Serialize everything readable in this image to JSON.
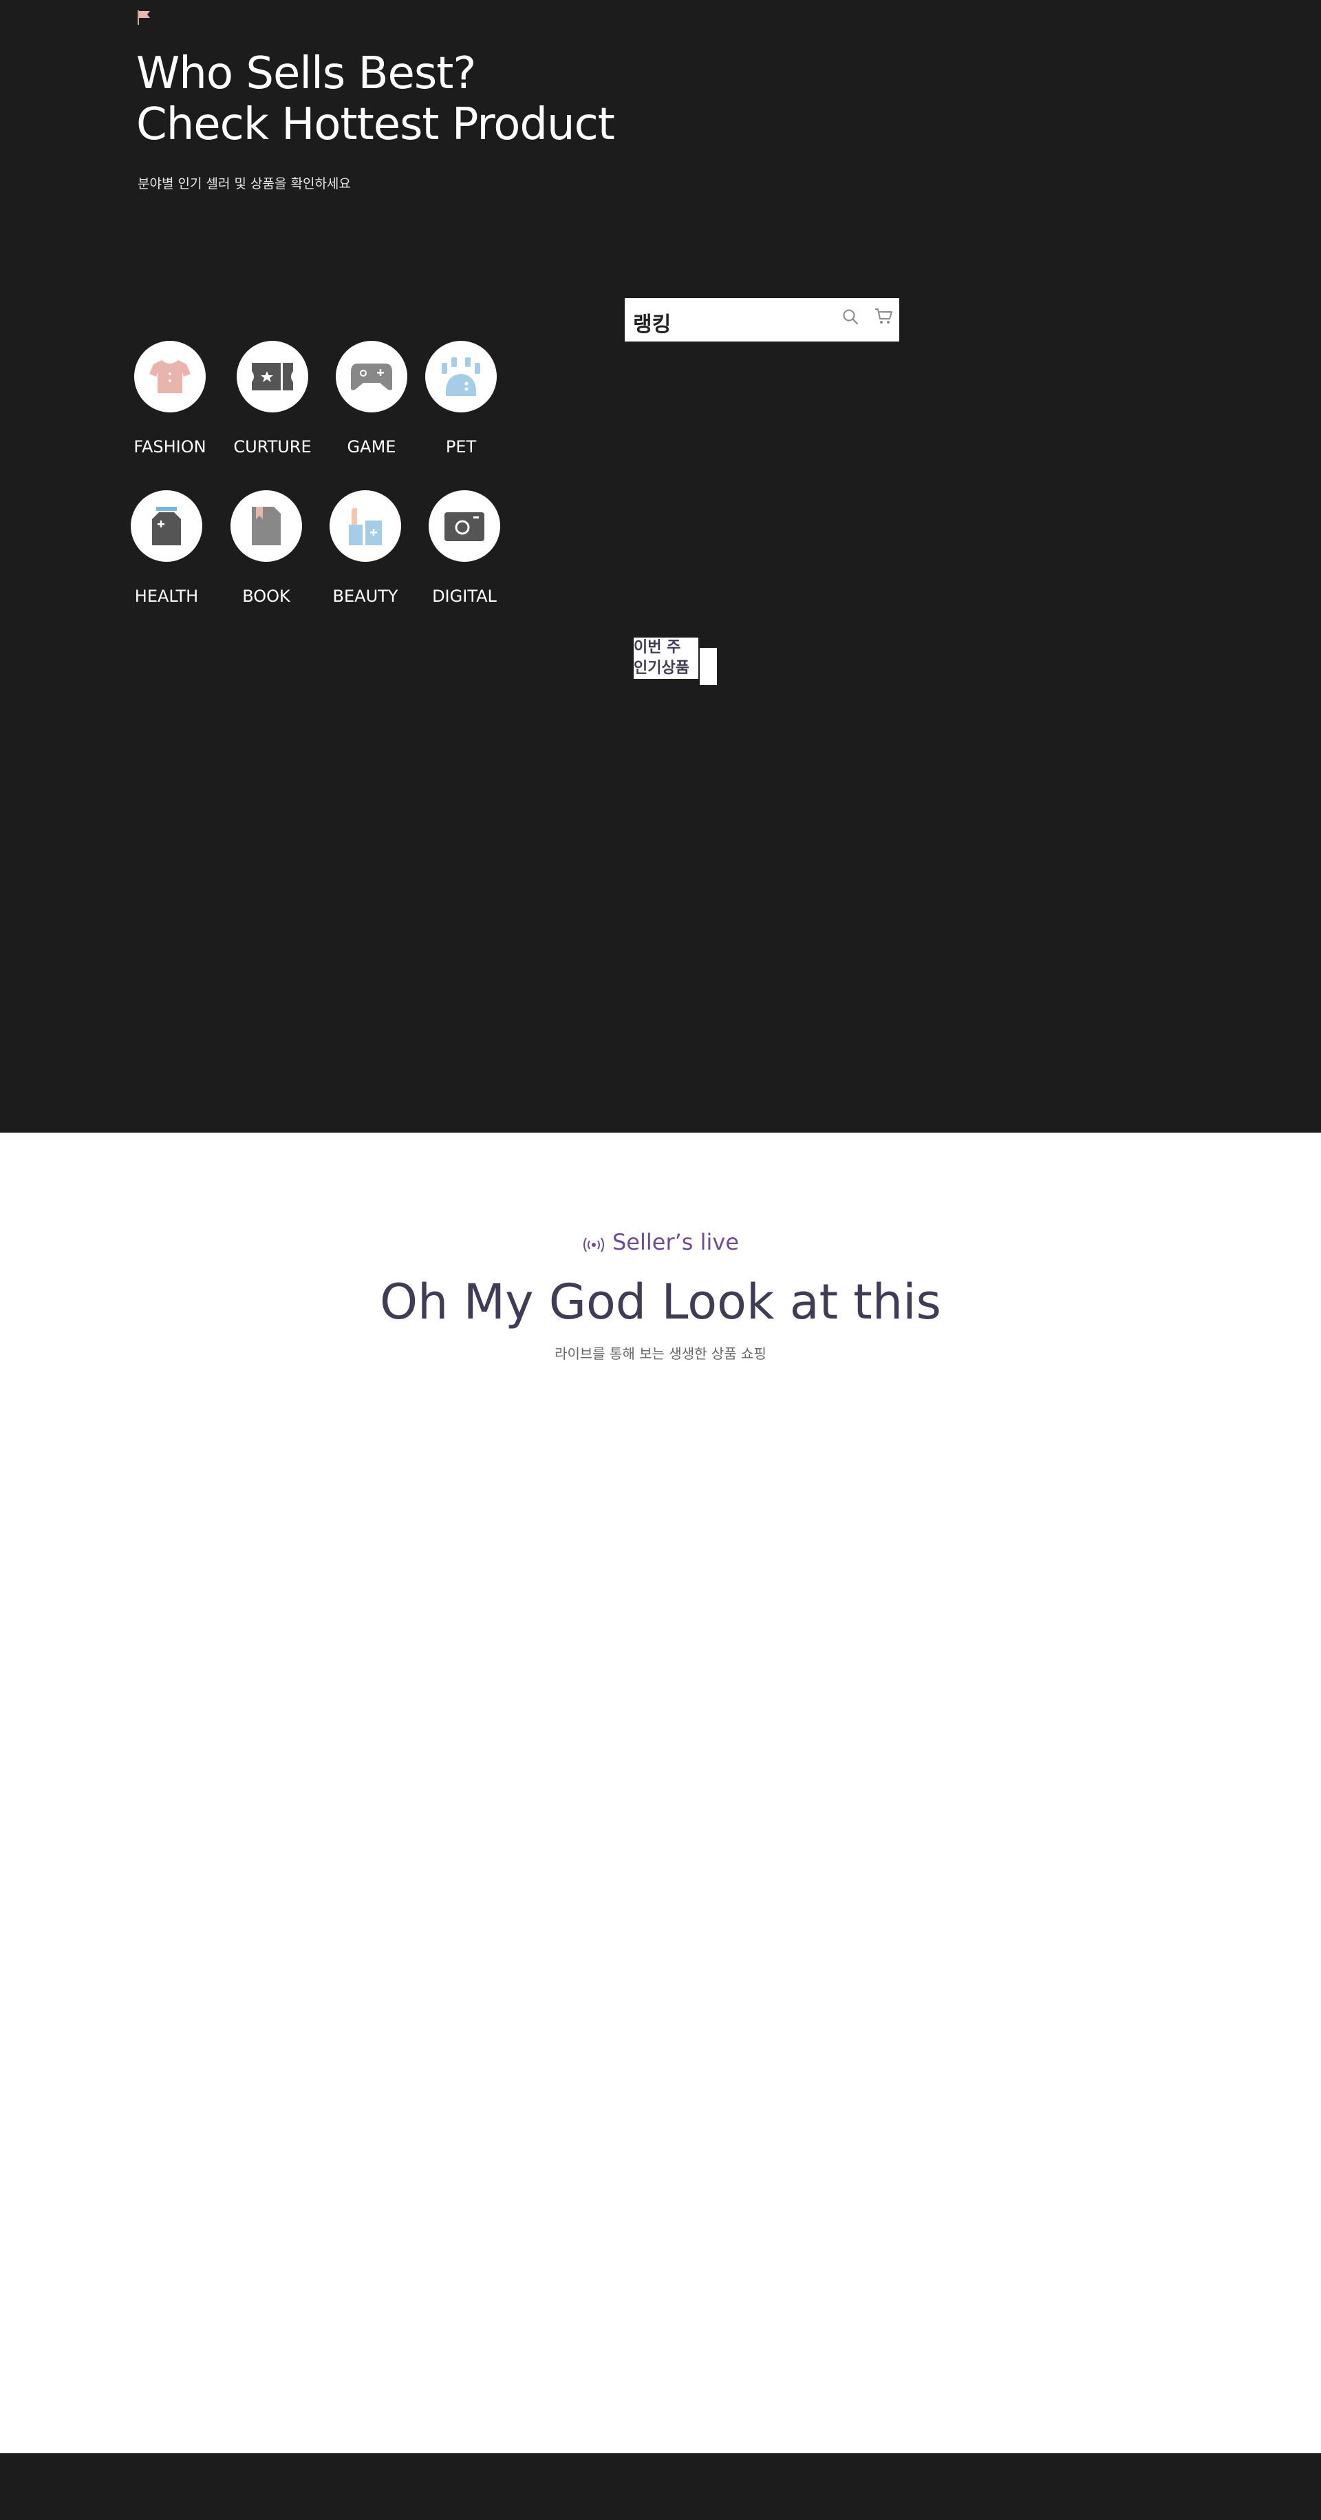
{
  "hero": {
    "title_line1": "Who Sells Best?",
    "title_line2": "Check Hottest Product",
    "subtitle": "분야별 인기 셀러 및 상품을 확인하세요"
  },
  "categories": [
    {
      "label": "FASHION",
      "icon": "shirt-icon"
    },
    {
      "label": "CURTURE",
      "icon": "ticket-icon"
    },
    {
      "label": "GAME",
      "icon": "gamepad-icon"
    },
    {
      "label": "PET",
      "icon": "paw-icon"
    },
    {
      "label": "HEALTH",
      "icon": "medicine-bottle-icon"
    },
    {
      "label": "BOOK",
      "icon": "book-icon"
    },
    {
      "label": "BEAUTY",
      "icon": "cosmetics-icon"
    },
    {
      "label": "DIGITAL",
      "icon": "camera-icon"
    }
  ],
  "ranking": {
    "title": "랭킹",
    "weekly_label": "이번 주 인기상품"
  },
  "live": {
    "eyebrow": "Seller’s live",
    "heading": "Oh My God Look at this",
    "subtitle": "라이브를 통해 보는 생생한 상품 쇼핑"
  },
  "colors": {
    "dark_bg": "#1c1c1c",
    "accent_purple": "#6e4c95",
    "heading_navy": "#3f3d56"
  }
}
